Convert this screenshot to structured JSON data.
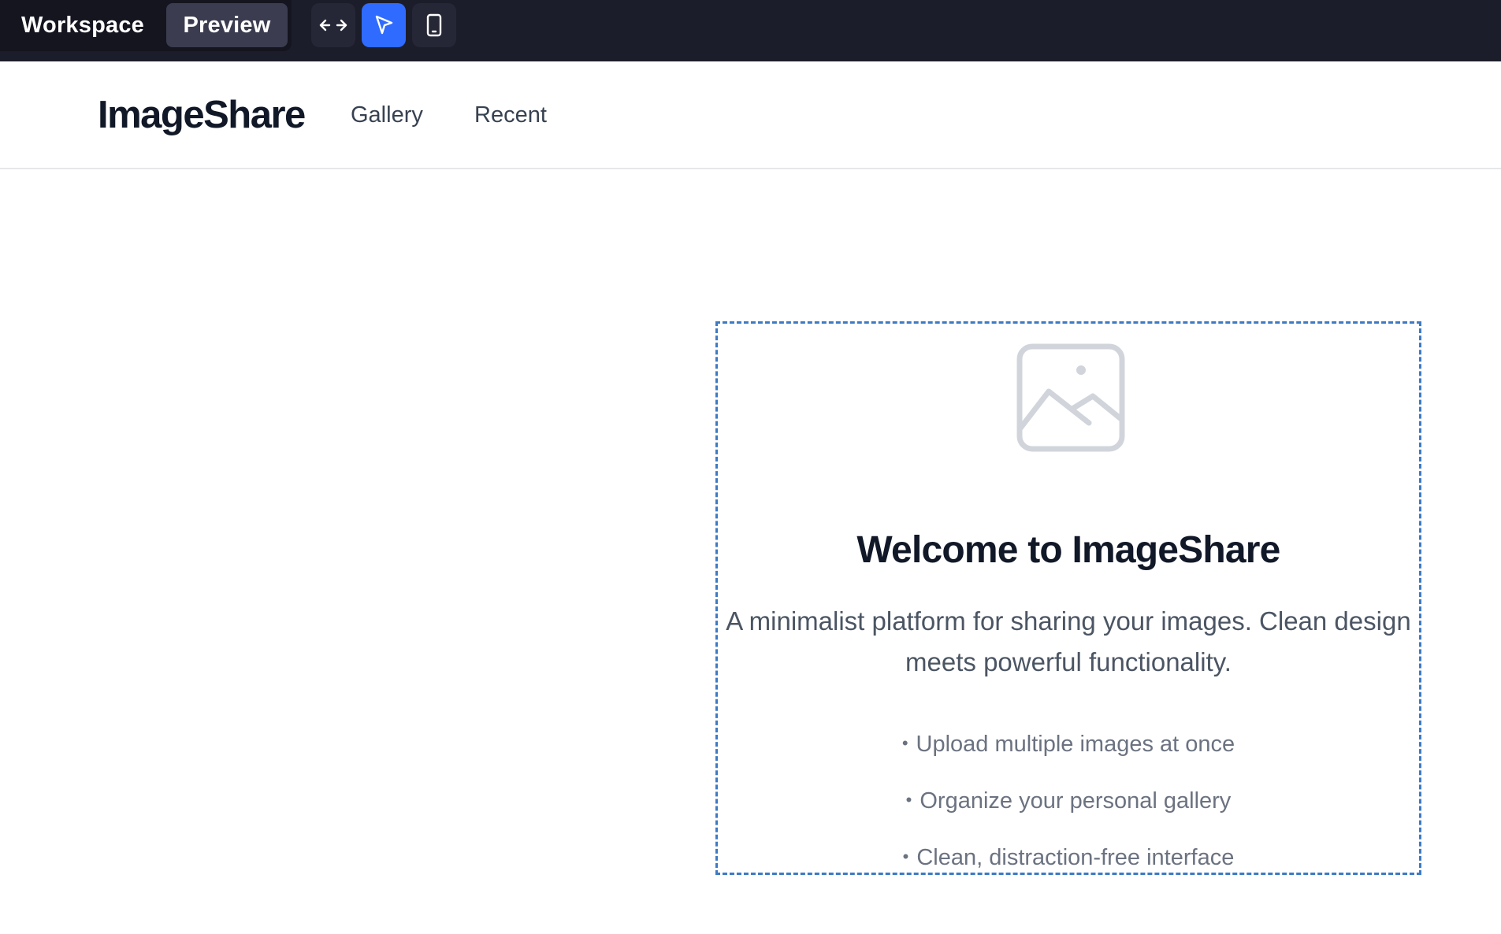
{
  "workspace_bar": {
    "modes": [
      "Workspace",
      "Preview"
    ],
    "active_mode": "Preview",
    "tools": [
      {
        "icon": "resize-horizontal-icon",
        "active": false
      },
      {
        "icon": "cursor-pointer-icon",
        "active": true
      },
      {
        "icon": "mobile-device-icon",
        "active": false
      }
    ]
  },
  "navbar": {
    "brand": "ImageShare",
    "links": [
      "Gallery",
      "Recent"
    ]
  },
  "welcome_card": {
    "icon": "image-placeholder-icon",
    "title": "Welcome to ImageShare",
    "description": "A minimalist platform for sharing your images. Clean design meets powerful functionality.",
    "bullet": "•",
    "features": [
      "Upload multiple images at once",
      "Organize your personal gallery",
      "Clean, distraction-free interface"
    ]
  },
  "colors": {
    "topbar_bg": "#1c1d2b",
    "active_tool": "#2f6bff",
    "card_border": "#3d7ac4",
    "title_text": "#111827"
  }
}
